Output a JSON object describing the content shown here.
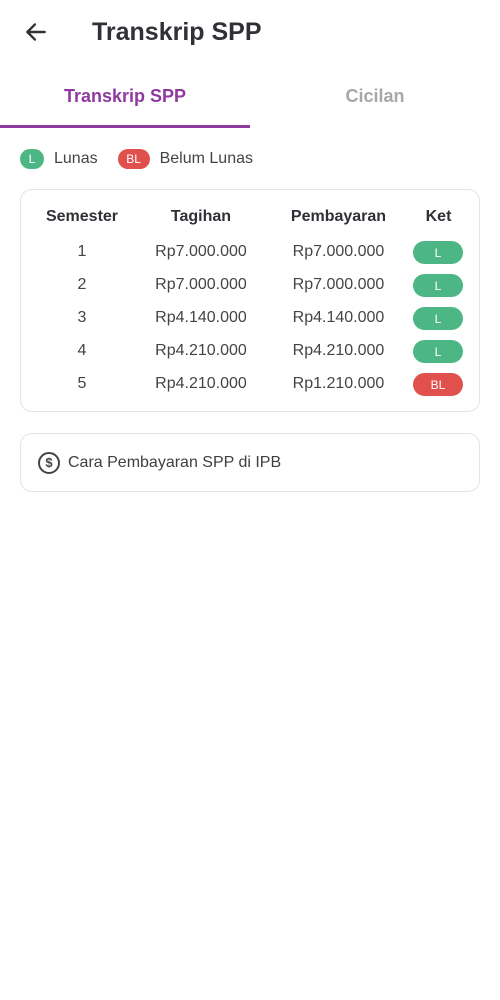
{
  "header": {
    "title": "Transkrip SPP",
    "back_icon": "arrow-left-icon"
  },
  "tabs": [
    {
      "label": "Transkrip SPP",
      "active": true
    },
    {
      "label": "Cicilan",
      "active": false
    }
  ],
  "legend": [
    {
      "code": "L",
      "label": "Lunas",
      "color": "#4cb784"
    },
    {
      "code": "BL",
      "label": "Belum Lunas",
      "color": "#e0504d"
    }
  ],
  "table": {
    "headers": {
      "semester": "Semester",
      "tagihan": "Tagihan",
      "pembayaran": "Pembayaran",
      "ket": "Ket"
    },
    "rows": [
      {
        "semester": "1",
        "tagihan": "Rp7.000.000",
        "pembayaran": "Rp7.000.000",
        "ket": "L"
      },
      {
        "semester": "2",
        "tagihan": "Rp7.000.000",
        "pembayaran": "Rp7.000.000",
        "ket": "L"
      },
      {
        "semester": "3",
        "tagihan": "Rp4.140.000",
        "pembayaran": "Rp4.140.000",
        "ket": "L"
      },
      {
        "semester": "4",
        "tagihan": "Rp4.210.000",
        "pembayaran": "Rp4.210.000",
        "ket": "L"
      },
      {
        "semester": "5",
        "tagihan": "Rp4.210.000",
        "pembayaran": "Rp1.210.000",
        "ket": "BL"
      }
    ]
  },
  "info": {
    "icon": "dollar-circle-icon",
    "label": "Cara Pembayaran SPP di IPB"
  },
  "colors": {
    "accent": "#8e3a9e",
    "lunas": "#4cb784",
    "belum_lunas": "#e0504d"
  }
}
